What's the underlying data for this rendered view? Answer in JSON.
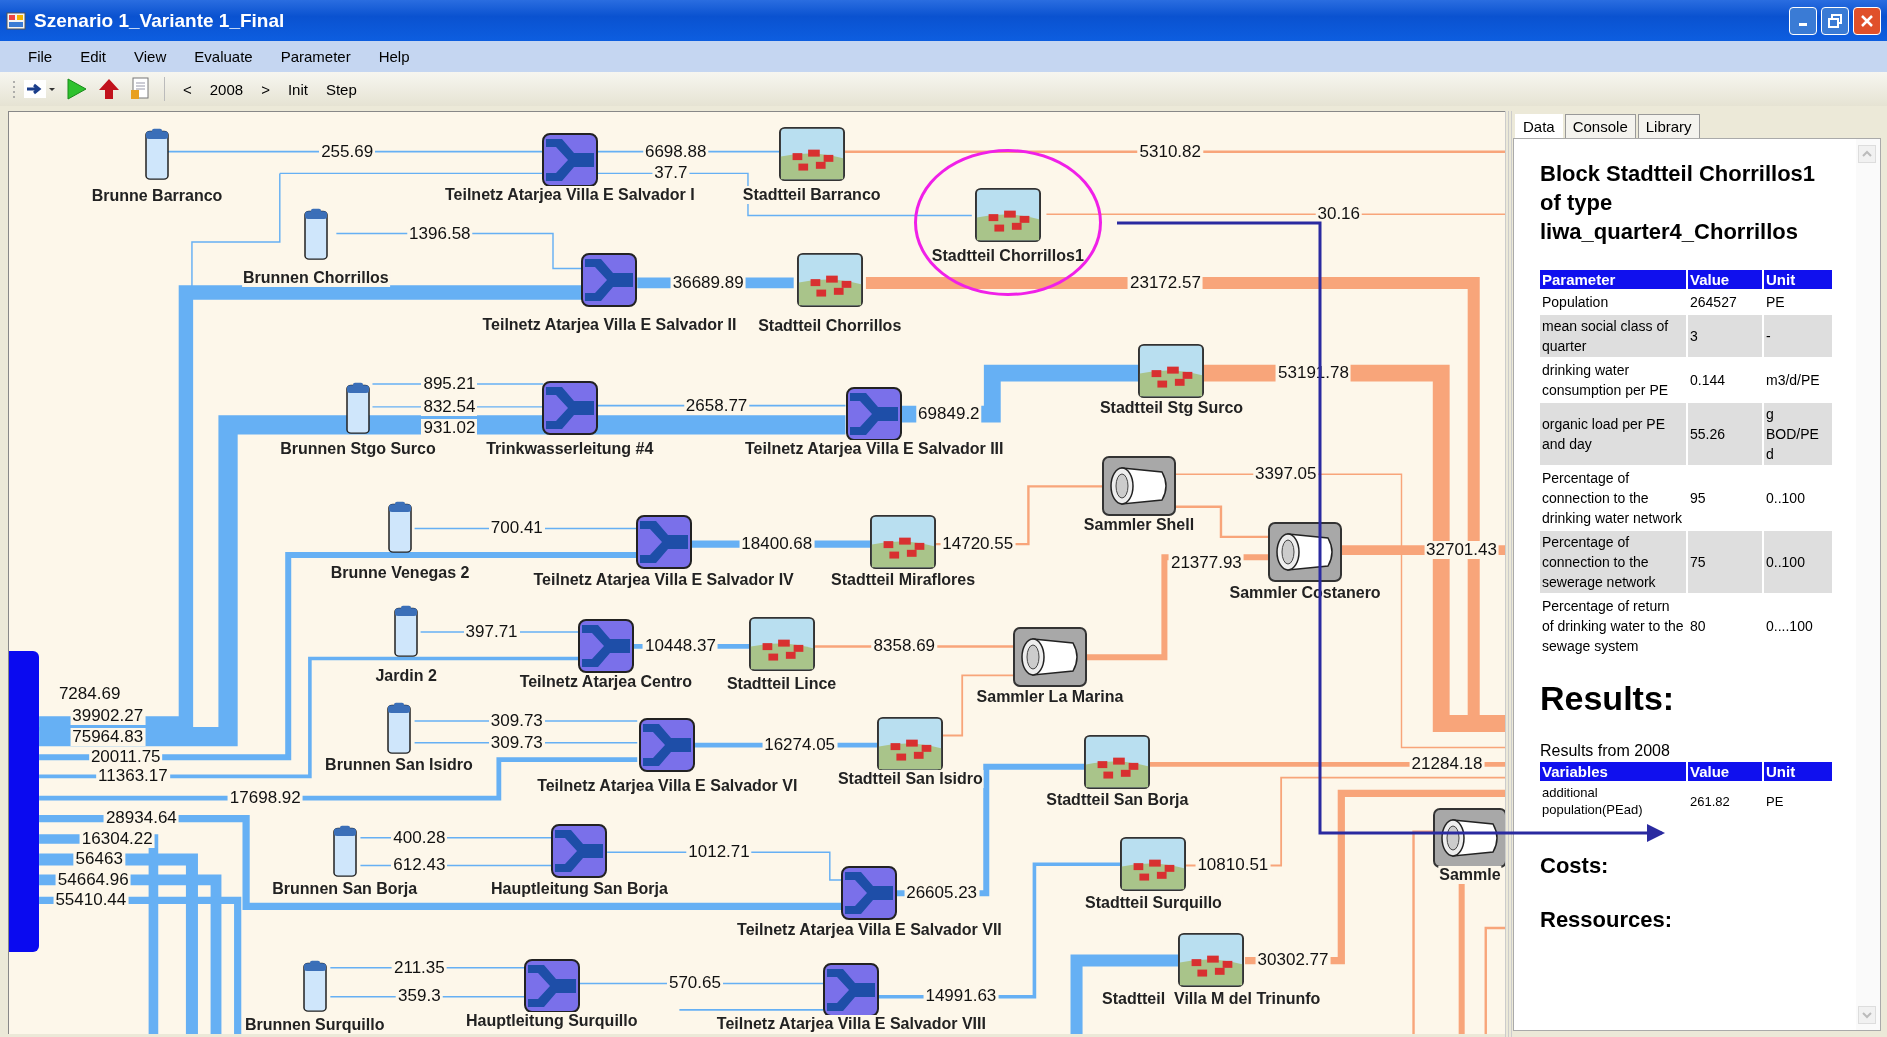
{
  "window": {
    "title": "Szenario 1_Variante 1_Final"
  },
  "menu": [
    "File",
    "Edit",
    "View",
    "Evaluate",
    "Parameter",
    "Help"
  ],
  "toolbar": {
    "prev": "<",
    "year": "2008",
    "next": ">",
    "buttons": [
      "Init",
      "Step"
    ]
  },
  "diagram": {
    "nodes": [
      {
        "kind": "well",
        "label": "Brunne Barranco",
        "selected": false
      },
      {
        "kind": "junction",
        "label": "Teilnetz Atarjea Villa E Salvador I",
        "selected": false
      },
      {
        "kind": "quarter",
        "label": "Stadtteil Barranco",
        "selected": false
      },
      {
        "kind": "quarter",
        "label": "Stadtteil Chorrillos1",
        "selected": true
      },
      {
        "kind": "well",
        "label": "Brunnen Chorrillos",
        "selected": false
      },
      {
        "kind": "junction",
        "label": "Teilnetz Atarjea Villa E Salvador II",
        "selected": false
      },
      {
        "kind": "quarter",
        "label": "Stadtteil Chorrillos",
        "selected": false
      },
      {
        "kind": "quarter",
        "label": "Stadtteil Stg Surco",
        "selected": false
      },
      {
        "kind": "well",
        "label": "Brunnen Stgo Surco",
        "selected": false
      },
      {
        "kind": "junction",
        "label": "Trinkwasserleitung #4",
        "selected": false
      },
      {
        "kind": "junction",
        "label": "Teilnetz Atarjea Villa E Salvador III",
        "selected": false
      },
      {
        "kind": "collector",
        "label": "Sammler Shell",
        "selected": false
      },
      {
        "kind": "well",
        "label": "Brunne Venegas 2",
        "selected": false
      },
      {
        "kind": "junction",
        "label": "Teilnetz Atarjea Villa E Salvador IV",
        "selected": false
      },
      {
        "kind": "quarter",
        "label": "Stadtteil Miraflores",
        "selected": false
      },
      {
        "kind": "collector",
        "label": "Sammler Costanero",
        "selected": false
      },
      {
        "kind": "reservoir",
        "selected": false
      },
      {
        "kind": "well",
        "label": "Jardin 2",
        "selected": false
      },
      {
        "kind": "junction",
        "label": "Teilnetz Atarjea Centro",
        "selected": false
      },
      {
        "kind": "quarter",
        "label": "Stadtteil Lince",
        "selected": false
      },
      {
        "kind": "collector",
        "label": "Sammler La Marina",
        "selected": false
      },
      {
        "kind": "well",
        "label": "Brunnen San Isidro",
        "selected": false
      },
      {
        "kind": "junction",
        "label": "Teilnetz Atarjea Villa E Salvador VI",
        "selected": false
      },
      {
        "kind": "quarter",
        "label": "Stadtteil San Isidro",
        "selected": false
      },
      {
        "kind": "quarter",
        "label": "Stadtteil San Borja",
        "selected": false
      },
      {
        "kind": "well",
        "label": "Brunnen San Borja",
        "selected": false
      },
      {
        "kind": "junction",
        "label": "Hauptleitung San Borja",
        "selected": false
      },
      {
        "kind": "collector",
        "label": "Sammle",
        "selected": false
      },
      {
        "kind": "junction",
        "label": "Teilnetz Atarjea Villa E Salvador VII",
        "selected": false
      },
      {
        "kind": "quarter",
        "label": "Stadtteil Surquillo",
        "selected": false
      },
      {
        "kind": "well",
        "label": "Brunnen Surquillo",
        "selected": false
      },
      {
        "kind": "junction",
        "label": "Hauptleitung Surquillo",
        "selected": false
      },
      {
        "kind": "junction",
        "label": "Teilnetz Atarjea Villa E Salvador VIII",
        "selected": false
      },
      {
        "kind": "quarter",
        "label": "Stadtteil  Villa M del Trinunfo",
        "selected": false
      }
    ],
    "flows": [
      "255.69",
      "6698.88",
      "37.7",
      "5310.82",
      "30.16",
      "1396.58",
      "36689.89",
      "23172.57",
      "895.21",
      "832.54",
      "931.02",
      "2658.77",
      "69849.2",
      "53191.78",
      "3397.05",
      "700.41",
      "18400.68",
      "14720.55",
      "32701.43",
      "21377.93",
      "397.71",
      "10448.37",
      "8358.69",
      "7284.69",
      "39902.27",
      "309.73",
      "75964.83",
      "309.73",
      "16274.05",
      "20011.75",
      "21284.18",
      "11363.17",
      "17698.92",
      "28934.64",
      "16304.22",
      "400.28",
      "1012.71",
      "56463",
      "612.43",
      "10810.51",
      "54664.96",
      "26605.23",
      "55410.44",
      "30302.77",
      "211.35",
      "570.65",
      "359.3",
      "14991.63"
    ]
  },
  "panel": {
    "tabs": [
      {
        "label": "Data",
        "selected": true
      },
      {
        "label": "Console",
        "selected": false
      },
      {
        "label": "Library",
        "selected": false
      }
    ],
    "heading": "Block Stadtteil Chorrillos1 of type liwa_quarter4_Chorrillos",
    "parameters": {
      "columns": [
        "Parameter",
        "Value",
        "Unit"
      ],
      "rows": [
        [
          "Population",
          "264527",
          "PE"
        ],
        [
          "mean social class of quarter",
          "3",
          "-"
        ],
        [
          "drinking water consumption per PE",
          "0.144",
          "m3/d/PE"
        ],
        [
          "organic load per PE and day",
          "55.26",
          "g BOD/PE d"
        ],
        [
          "Percentage of connection to the drinking water network",
          "95",
          "0..100"
        ],
        [
          "Percentage of connection to the sewerage network",
          "75",
          "0..100"
        ],
        [
          "Percentage of return of drinking water to the sewage system",
          "80",
          "0....100"
        ]
      ]
    },
    "results_heading": "Results:",
    "results_caption": "Results from 2008",
    "results": {
      "columns": [
        "Variables",
        "Value",
        "Unit"
      ],
      "rows": [
        [
          "additional population(PEad)",
          "261.82",
          "PE"
        ]
      ]
    },
    "costs_heading": "Costs:",
    "resources_heading": "Ressources:"
  }
}
